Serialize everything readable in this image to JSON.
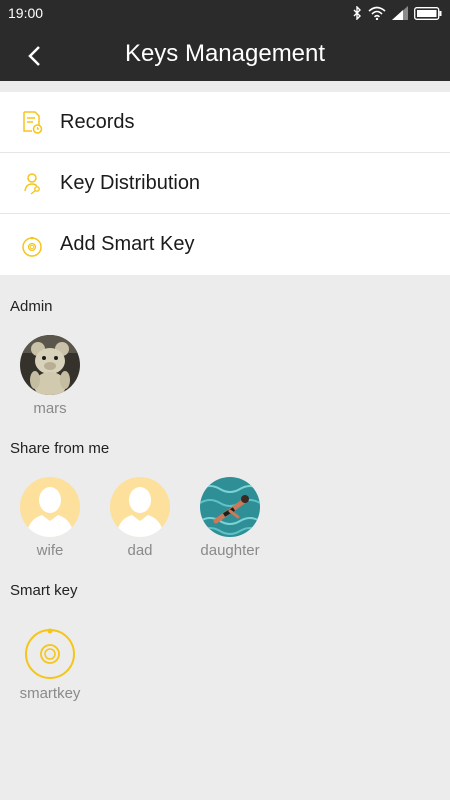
{
  "status_bar": {
    "time": "19:00",
    "icons": [
      "bluetooth-icon",
      "wifi-icon",
      "signal-icon",
      "battery-icon"
    ]
  },
  "toolbar": {
    "title": "Keys Management",
    "back_icon": "chevron-left-icon"
  },
  "menu": [
    {
      "label": "Records",
      "icon": "records-icon"
    },
    {
      "label": "Key Distribution",
      "icon": "key-person-icon"
    },
    {
      "label": "Add Smart Key",
      "icon": "smart-key-icon"
    }
  ],
  "sections": {
    "admin": {
      "title": "Admin",
      "members": [
        {
          "name": "mars",
          "avatar": "teddy-bear-photo"
        }
      ]
    },
    "shared": {
      "title": "Share from me",
      "members": [
        {
          "name": "wife",
          "avatar": "default-person-icon"
        },
        {
          "name": "dad",
          "avatar": "default-person-icon"
        },
        {
          "name": "daughter",
          "avatar": "swimmer-photo"
        }
      ]
    },
    "smart_key": {
      "title": "Smart key",
      "members": [
        {
          "name": "smartkey",
          "avatar": "smart-key-icon"
        }
      ]
    }
  },
  "colors": {
    "accent": "#f5c518",
    "header": "#2b2b2b",
    "background": "#ececec",
    "avatar_placeholder": "#fce09b"
  }
}
